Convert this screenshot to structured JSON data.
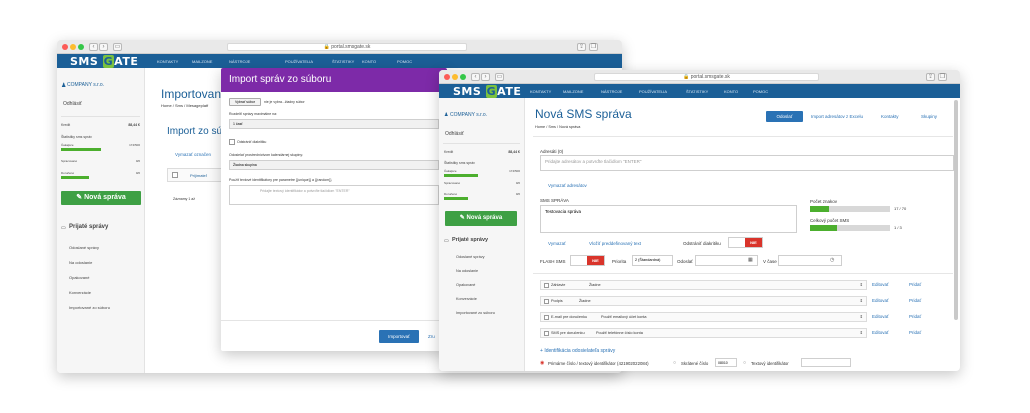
{
  "back_window": {
    "url": "portal.smsgate.sk",
    "logo": {
      "a": "SMS ",
      "b": "G",
      "c": "ATE"
    },
    "nav": [
      "KONTAKTY",
      "MAILZONE",
      "NÁSTROJE",
      "POUŽÍVATELIA",
      "ŠTATISTIKY",
      "KONTO",
      "POMOC"
    ],
    "company": "COMPANY s.r.o.",
    "logout": "Odhlásiť",
    "kredit_label": "Kredit",
    "kredit_value": "88,44 €",
    "stats_title": "Štatistiky sms správ",
    "stats": [
      {
        "label": "Čakajúce",
        "value": "174/500"
      },
      {
        "label": "Spracované",
        "value": "0/0"
      },
      {
        "label": "Doručené",
        "value": "0/0"
      }
    ],
    "new_message": "Nová správa",
    "received": "Prijaté správy",
    "menu": [
      "Odoslané správy",
      "Na odoslanie",
      "Opakované",
      "Konverzácie",
      "Importované zo súboru"
    ],
    "page_title": "Importovan",
    "breadcrumb": [
      "Home",
      "Sms",
      "Mesageplatf"
    ],
    "section_title": "Import zo súbo",
    "export_link": "Vymazať označen",
    "table_head": "Prijímateľ",
    "pagination": "Záznamy 1 až"
  },
  "modal": {
    "title": "Import správ zo súboru",
    "file_button": "Vybrať súbor",
    "file_status": "nie je vybra...žiadny súbor",
    "split_label": "Rozdeliť správy maximálne na:",
    "split_value": "1 časť",
    "diacritics_label": "Odstrániť diakritiku",
    "sender_label": "Odosielať prostredníctvom kalendárnej skupiny:",
    "sender_value": "Žiadna skupina",
    "id_label": "Použiť textové identifikátory pre parametre {{unique}} a {{random}}",
    "id_placeholder": "Pridajte textový identifikátor a potvrďte tlačidlom \"ENTER\"",
    "import_button": "Importovať",
    "cancel_partial": "Zru"
  },
  "front_window": {
    "url": "portal.smsgate.sk",
    "logo": {
      "a": "SMS ",
      "b": "G",
      "c": "ATE"
    },
    "nav": [
      "KONTAKTY",
      "MAILZONE",
      "NÁSTROJE",
      "POUŽÍVATELIA",
      "ŠTATISTIKY",
      "KONTO",
      "POMOC"
    ],
    "company": "COMPANY s.r.o.",
    "logout": "Odhlásiť",
    "kredit_label": "Kredit",
    "kredit_value": "88,44 €",
    "stats_title": "Štatistiky sms správ",
    "stats": [
      {
        "label": "Čakajúce",
        "value": "174/500"
      },
      {
        "label": "Spracované",
        "value": "0/0"
      },
      {
        "label": "Doručené",
        "value": "0/0"
      }
    ],
    "new_message": "Nová správa",
    "received": "Prijaté správy",
    "menu": [
      "Odoslané správy",
      "Na odoslanie",
      "Opakované",
      "Konverzácie",
      "Importované zo súboru"
    ],
    "page_title": "Nová SMS správa",
    "breadcrumb": [
      "Home",
      "Sms",
      "Nová správa"
    ],
    "send_button": "Odoslať",
    "import_excel": "Import adresátov z Excelu",
    "contacts": "Kontakty",
    "groups": "Skupiny",
    "recipients_label": "Adresáti (0)",
    "recipients_placeholder": "Pridajte adresátov a potvrďte tlačidlom \"ENTER\"",
    "clear_recipients": "Vymazať adresátov",
    "sms_label": "SMS SPRÁVA",
    "sms_text": "Testovacia správa",
    "char_count_label": "Počet znakov",
    "char_count_value": "17 / 70",
    "char_fill": 0.24,
    "sms_count_label": "Celkový počet SMS",
    "sms_count_value": "1 / 3",
    "sms_fill": 0.33,
    "clear_button": "Vymazať",
    "insert_text": "Vložiť preddefinovaný text",
    "diacritics_label": "Odstrániť diakritiku",
    "toggle_value": "NIE",
    "flash_label": "FLASH SMS",
    "priority_label": "Priorita",
    "priority_value": "2 (Štandardná)",
    "send_label": "Odoslať",
    "time_label": "V čase",
    "rows": [
      {
        "label": "Záhlavie",
        "value": "Žiadne"
      },
      {
        "label": "Podpis",
        "value": "Žiadne"
      },
      {
        "label": "E-mail pre doručenku",
        "value": "Použiť emailový účet konta"
      },
      {
        "label": "SMS pre doručenku",
        "value": "Použiť telefónne číslo konta"
      }
    ],
    "edit_label": "Editovať",
    "add_label": "Pridať",
    "sender_section": "Identifikácia odosielateľa správy",
    "radio_primary": "Primárne číslo / textový identifikátor (421902022084)",
    "radio_short": "Skrátené číslo",
    "short_value": "08010",
    "radio_text": "Textový identifikátor"
  }
}
